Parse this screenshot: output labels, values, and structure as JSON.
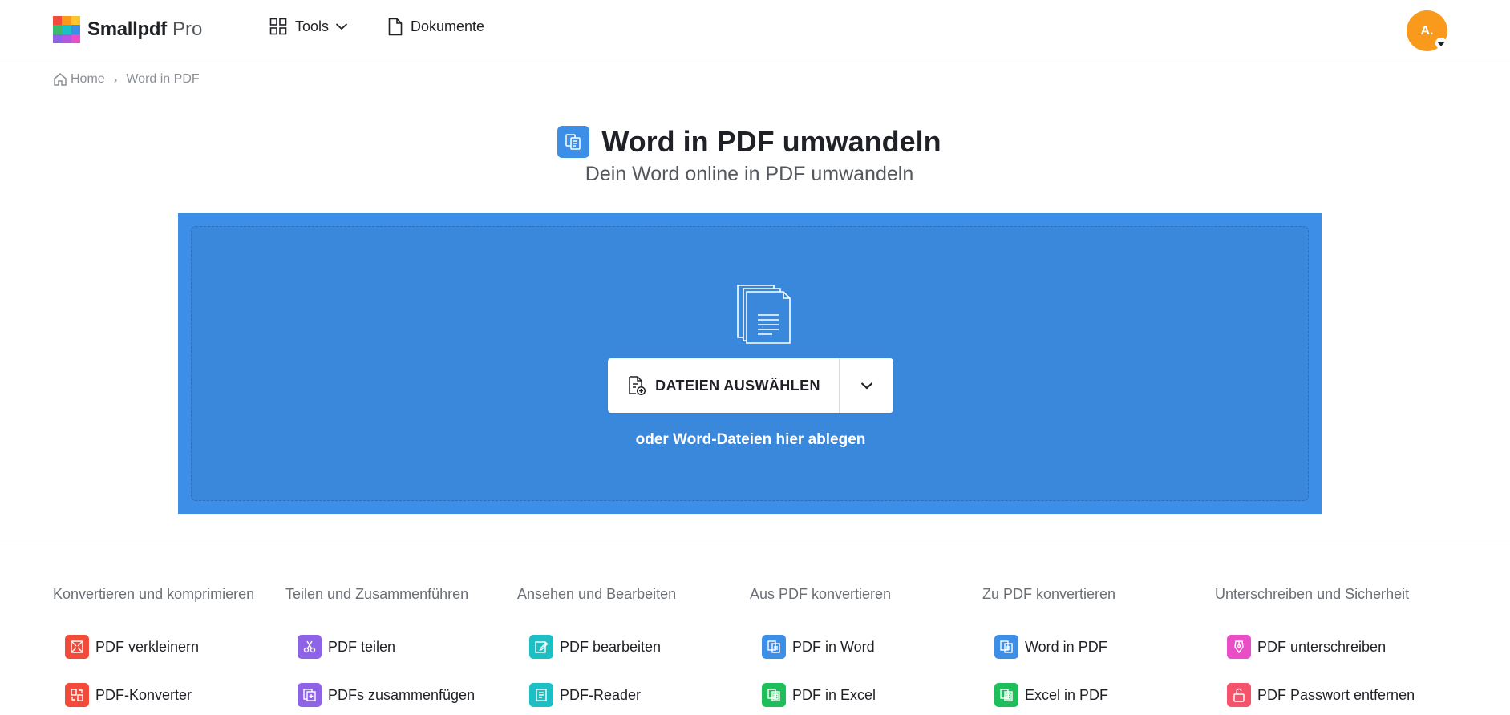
{
  "brand": {
    "name": "Smallpdf",
    "plan": "Pro",
    "logo_colors": [
      "#f34b3b",
      "#f99a1c",
      "#fbc62d",
      "#3aba6f",
      "#1cc0c4",
      "#3d8ee6",
      "#8f63e8",
      "#b654e6",
      "#e94ec6"
    ]
  },
  "nav": {
    "tools_label": "Tools",
    "documents_label": "Dokumente"
  },
  "user": {
    "initials": "A."
  },
  "breadcrumb": {
    "home": "Home",
    "current": "Word in PDF"
  },
  "hero": {
    "title": "Word in PDF umwandeln",
    "subtitle": "Dein Word online in PDF umwandeln",
    "accent_color": "#3d8ee6"
  },
  "upload": {
    "select_label": "DATEIEN AUSWÄHLEN",
    "drop_hint": "oder Word-Dateien hier ablegen"
  },
  "categories": [
    {
      "heading": "Konvertieren und komprimieren",
      "tools": [
        {
          "label": "PDF verkleinern",
          "color": "#f34b3b",
          "icon": "compress-icon"
        },
        {
          "label": "PDF-Konverter",
          "color": "#f34b3b",
          "icon": "convert-icon"
        }
      ]
    },
    {
      "heading": "Teilen und Zusammenführen",
      "tools": [
        {
          "label": "PDF teilen",
          "color": "#8f63e8",
          "icon": "scissors-icon"
        },
        {
          "label": "PDFs zusammenfügen",
          "color": "#8f63e8",
          "icon": "merge-icon"
        }
      ]
    },
    {
      "heading": "Ansehen und Bearbeiten",
      "tools": [
        {
          "label": "PDF bearbeiten",
          "color": "#1cc0c4",
          "icon": "edit-icon"
        },
        {
          "label": "PDF-Reader",
          "color": "#1cc0c4",
          "icon": "reader-icon"
        }
      ]
    },
    {
      "heading": "Aus PDF konvertieren",
      "tools": [
        {
          "label": "PDF in Word",
          "color": "#3d8ee6",
          "icon": "pdf-to-word-icon"
        },
        {
          "label": "PDF in Excel",
          "color": "#1ebe5a",
          "icon": "pdf-to-excel-icon"
        }
      ]
    },
    {
      "heading": "Zu PDF konvertieren",
      "tools": [
        {
          "label": "Word in PDF",
          "color": "#3d8ee6",
          "icon": "word-to-pdf-icon"
        },
        {
          "label": "Excel in PDF",
          "color": "#1ebe5a",
          "icon": "excel-to-pdf-icon"
        }
      ]
    },
    {
      "heading": "Unterschreiben und Sicherheit",
      "tools": [
        {
          "label": "PDF unterschreiben",
          "color": "#e94ec6",
          "icon": "sign-icon"
        },
        {
          "label": "PDF Passwort entfernen",
          "color": "#f5526b",
          "icon": "unlock-icon"
        }
      ]
    }
  ]
}
